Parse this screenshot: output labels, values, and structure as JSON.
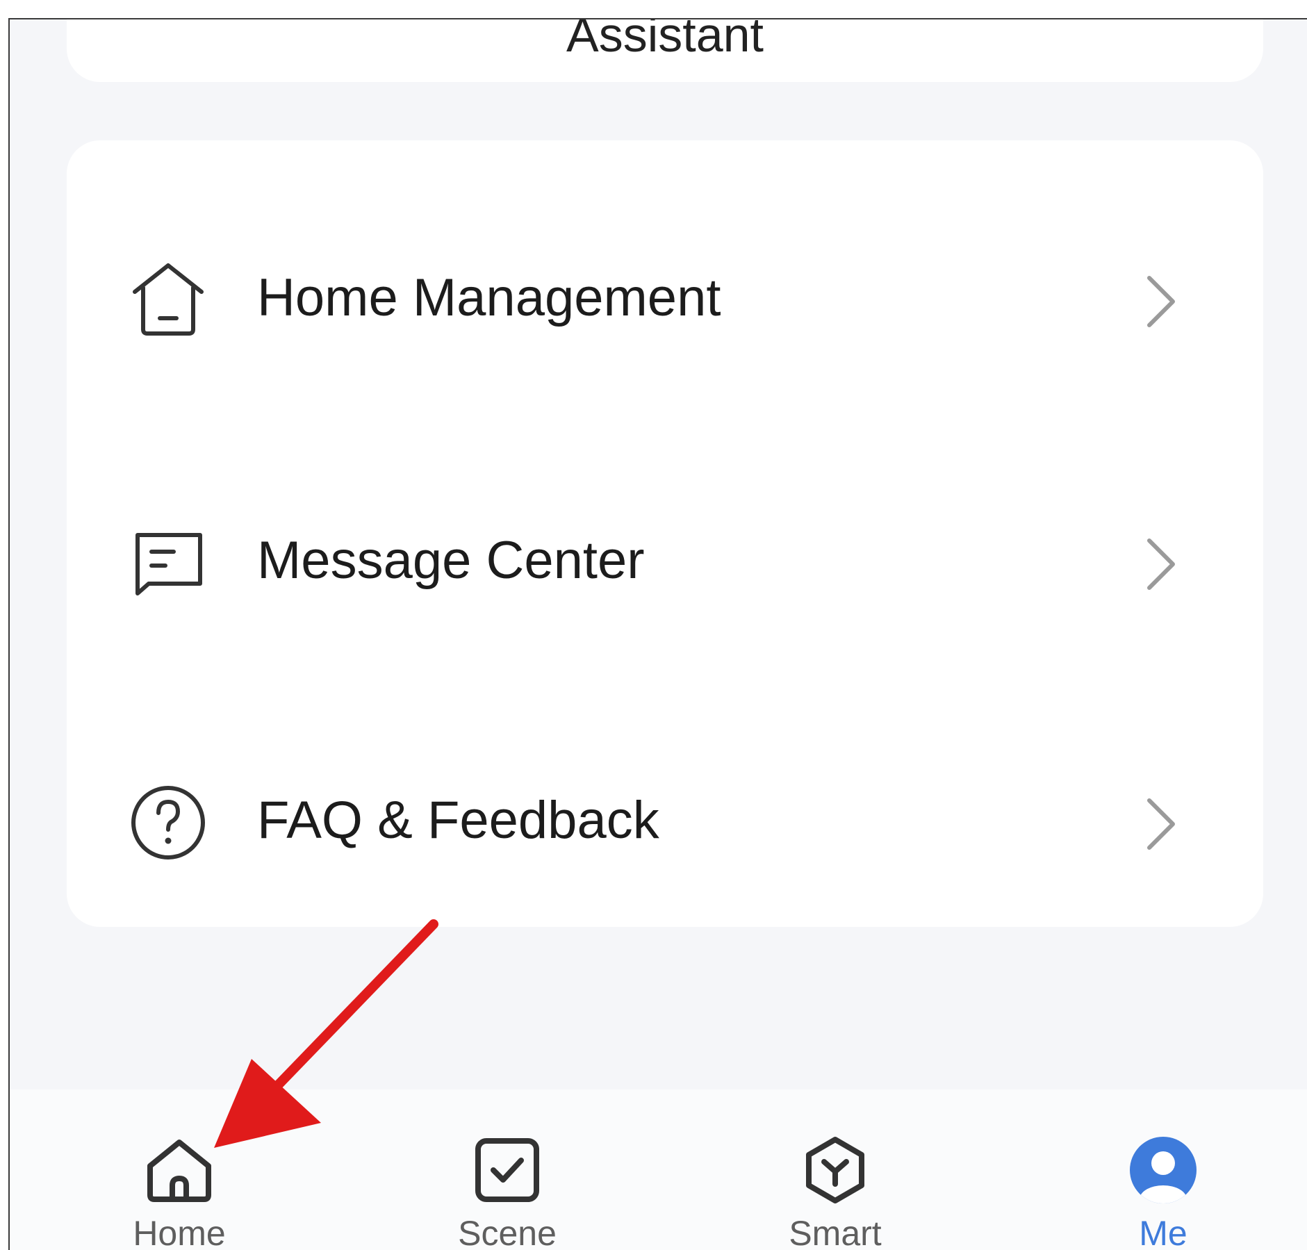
{
  "top_card": {
    "label": "Assistant"
  },
  "menu": {
    "items": [
      {
        "label": "Home Management",
        "icon": "house-outline-icon"
      },
      {
        "label": "Message Center",
        "icon": "message-icon"
      },
      {
        "label": "FAQ & Feedback",
        "icon": "question-circle-icon"
      }
    ]
  },
  "tabbar": {
    "tabs": [
      {
        "label": "Home",
        "icon": "home-icon",
        "active": false
      },
      {
        "label": "Scene",
        "icon": "checkbox-icon",
        "active": false
      },
      {
        "label": "Smart",
        "icon": "smart-hexagon-icon",
        "active": false
      },
      {
        "label": "Me",
        "icon": "profile-icon",
        "active": true
      }
    ]
  },
  "colors": {
    "background": "#f5f6f9",
    "card": "#ffffff",
    "text": "#1c1c1c",
    "tab_text": "#5e5e5e",
    "accent": "#3e7bdb",
    "annotation_arrow": "#e01b1b"
  }
}
